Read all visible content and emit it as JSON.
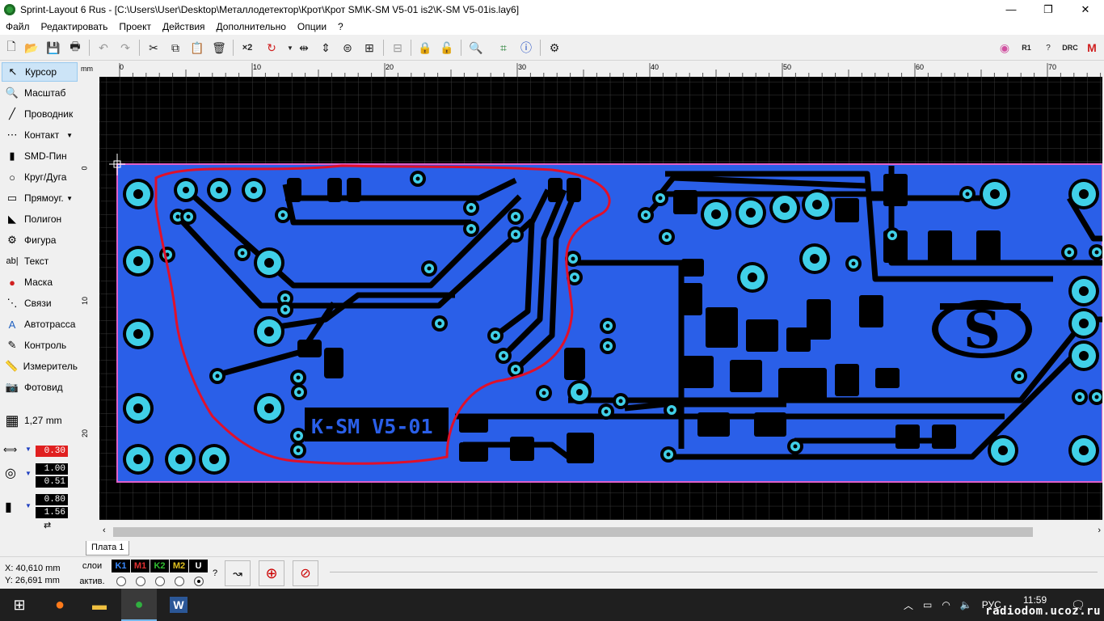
{
  "window": {
    "title": "Sprint-Layout 6 Rus - [C:\\Users\\User\\Desktop\\Металлодетектор\\Крот\\Крот SM\\K-SM V5-01 is2\\K-SM V5-01is.lay6]",
    "minimize": "—",
    "maximize": "❐",
    "close": "✕"
  },
  "menu": [
    "Файл",
    "Редактировать",
    "Проект",
    "Действия",
    "Дополнительно",
    "Опции",
    "?"
  ],
  "tools": [
    {
      "label": "Курсор",
      "icon": "cursor-icon"
    },
    {
      "label": "Масштаб",
      "icon": "zoom-icon"
    },
    {
      "label": "Проводник",
      "icon": "track-icon"
    },
    {
      "label": "Контакт",
      "icon": "pad-icon"
    },
    {
      "label": "SMD-Пин",
      "icon": "smd-pad-icon"
    },
    {
      "label": "Круг/Дуга",
      "icon": "circle-icon"
    },
    {
      "label": "Прямоуг.",
      "icon": "rectangle-icon"
    },
    {
      "label": "Полигон",
      "icon": "polygon-icon"
    },
    {
      "label": "Фигура",
      "icon": "shape-icon"
    },
    {
      "label": "Текст",
      "icon": "text-icon"
    },
    {
      "label": "Маска",
      "icon": "mask-icon"
    },
    {
      "label": "Связи",
      "icon": "connections-icon"
    },
    {
      "label": "Автотрасса",
      "icon": "autoroute-icon"
    },
    {
      "label": "Контроль",
      "icon": "check-icon"
    },
    {
      "label": "Измеритель",
      "icon": "measure-icon"
    },
    {
      "label": "Фотовид",
      "icon": "photoview-icon"
    }
  ],
  "grid": {
    "label": "1,27 mm"
  },
  "params": {
    "track_width": "0.30",
    "pad_outer": "1.00",
    "pad_inner": "0.51",
    "smd_w": "0.80",
    "smd_h": "1.56"
  },
  "ruler": {
    "unit": "mm",
    "top_ticks": [
      "0",
      "10",
      "20",
      "30",
      "40",
      "50",
      "60",
      "70"
    ],
    "left_ticks": [
      "0",
      "10",
      "20"
    ]
  },
  "board": {
    "label": "K-SM V5-01",
    "tab": "Плата 1",
    "colors": {
      "background": "#000000",
      "copper": "#2a5fe8",
      "pad": "#40d0e8",
      "outline": "#e060c8",
      "annotation": "#e0102a"
    }
  },
  "status": {
    "x": "X:   40,610 mm",
    "y": "Y:   26,691 mm",
    "layers_label": "слои",
    "active_label": "актив.",
    "layers": [
      "K1",
      "M1",
      "K2",
      "M2",
      "U"
    ],
    "help": "?"
  },
  "taskbar": {
    "lang": "РУС",
    "time": "11:59",
    "watermark": "radiodom.ucoz.ru"
  }
}
